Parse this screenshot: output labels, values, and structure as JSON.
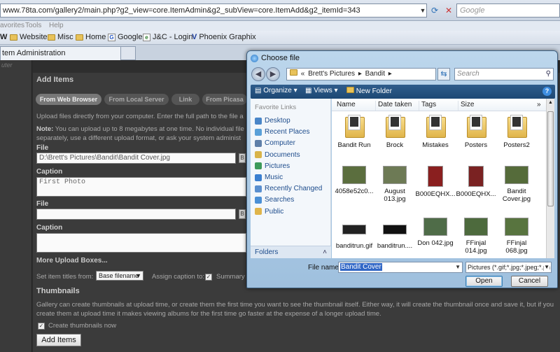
{
  "browser": {
    "address": "www.78ta.com/gallery2/main.php?g2_view=core.ItemAdmin&g2_subView=core.ItemAdd&g2_itemId=343",
    "search_placeholder": "Google",
    "menu": [
      "avorites",
      "Tools",
      "Help"
    ],
    "bookmarks": [
      {
        "label": "Website",
        "icon": "folder-icon"
      },
      {
        "label": "Misc",
        "icon": "folder-icon"
      },
      {
        "label": "Home",
        "icon": "folder-icon"
      },
      {
        "label": "Google",
        "icon": "google-icon"
      },
      {
        "label": "J&C - Login",
        "icon": "page-icon"
      },
      {
        "label": "Phoenix Graphix",
        "icon": "phoenix-icon"
      }
    ],
    "tab_title": "tem Administration"
  },
  "gallery": {
    "rail_text": "uter",
    "section_title": "Add Items",
    "tabs": [
      "From Web Browser",
      "From Local Server",
      "Link",
      "From Picasa"
    ],
    "intro_line1": "Upload files directly from your computer. Enter the full path to the file a",
    "note_label": "Note:",
    "note_line1": " You can upload up to 8 megabytes at one time. No individual file",
    "note_line2": "separately, use a different upload format, or ask your system administ",
    "file_label": "File",
    "file1_value": "D:\\Brett's Pictures\\Bandit\\Bandit Cover.jpg",
    "caption_label": "Caption",
    "caption1_value": "First Photo",
    "file2_value": "",
    "caption2_value": "",
    "more_boxes": "More Upload Boxes...",
    "set_titles_label": "Set item titles from:",
    "set_titles_value": "Base filename",
    "assign_caption_label": "Assign caption to:",
    "summary_label": "Summary",
    "thumbnails_title": "Thumbnails",
    "thumb_line1": "Gallery can create thumbnails at upload time, or create them the first time you want to see the thumbnail itself. Either way, it will create the thumbnail once and save it, but if you",
    "thumb_line2": "create them at upload time it makes viewing albums for the first time go faster at the expense of a longer upload time.",
    "create_thumbs_label": "Create thumbnails now",
    "add_items_button": "Add Items"
  },
  "dialog": {
    "title": "Choose file",
    "breadcrumb": [
      "Brett's Pictures",
      "Bandit"
    ],
    "search_placeholder": "Search",
    "toolbar": {
      "organize": "Organize",
      "views": "Views",
      "new_folder": "New Folder"
    },
    "favorite_links_title": "Favorite Links",
    "favorites": [
      {
        "label": "Desktop",
        "color": "#4a86c8"
      },
      {
        "label": "Recent Places",
        "color": "#5aa0d8"
      },
      {
        "label": "Computer",
        "color": "#5f7fa8"
      },
      {
        "label": "Documents",
        "color": "#d9b44a"
      },
      {
        "label": "Pictures",
        "color": "#3d9a5a"
      },
      {
        "label": "Music",
        "color": "#3b7fd0"
      },
      {
        "label": "Recently Changed",
        "color": "#5a8fcf"
      },
      {
        "label": "Searches",
        "color": "#4a8fd5"
      },
      {
        "label": "Public",
        "color": "#e0b54b"
      }
    ],
    "folders_label": "Folders",
    "columns": [
      "Name",
      "Date taken",
      "Tags",
      "Size"
    ],
    "items": [
      {
        "label": "Bandit Run",
        "kind": "folder"
      },
      {
        "label": "Brock",
        "kind": "folder"
      },
      {
        "label": "Mistakes",
        "kind": "folder"
      },
      {
        "label": "Posters",
        "kind": "folder"
      },
      {
        "label": "Posters2",
        "kind": "folder"
      },
      {
        "label": "4058e52c0...",
        "kind": "photo",
        "color": "#5b6e3e"
      },
      {
        "label": "August 013.jpg",
        "kind": "photo",
        "color": "#6d7a55"
      },
      {
        "label": "B000EQHX...",
        "kind": "poster",
        "color": "#8a1f1f"
      },
      {
        "label": "B000EQHX...",
        "kind": "poster",
        "color": "#7a2222"
      },
      {
        "label": "Bandit Cover.jpg",
        "kind": "photo",
        "color": "#556b3a"
      },
      {
        "label": "banditrun.gif",
        "kind": "logo",
        "color": "#222222"
      },
      {
        "label": "banditrun....",
        "kind": "logo",
        "color": "#111111"
      },
      {
        "label": "Don 042.jpg",
        "kind": "photo",
        "color": "#4f6c48"
      },
      {
        "label": "FFinjal 014.jpg",
        "kind": "photo",
        "color": "#4d6a3d"
      },
      {
        "label": "FFinjal 068.jpg",
        "kind": "photo",
        "color": "#58743f"
      }
    ],
    "file_name_label": "File name:",
    "file_name_value": "Bandit Cover",
    "file_type_value": "Pictures (*.gif;*.jpg;*.jpeg;*.pn",
    "open_button": "Open",
    "cancel_button": "Cancel"
  }
}
